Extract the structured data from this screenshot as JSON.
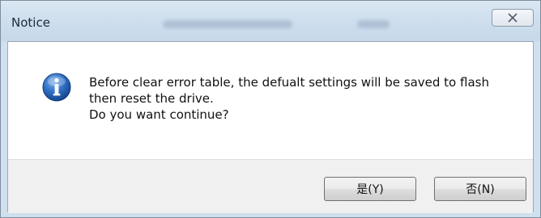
{
  "window": {
    "title": "Notice"
  },
  "message": {
    "lines": [
      "Before clear error table, the defualt settings will be saved to flash",
      "then reset the drive.",
      "Do you want continue?"
    ]
  },
  "buttons": {
    "yes_label": "是(Y)",
    "no_label": "否(N)"
  },
  "icons": {
    "message_icon": "information-icon",
    "close_icon": "close-icon"
  },
  "colors": {
    "titlebar": "#cfe0ef",
    "info_icon_blue": "#1f5fb3",
    "footer": "#f0f0f0"
  }
}
